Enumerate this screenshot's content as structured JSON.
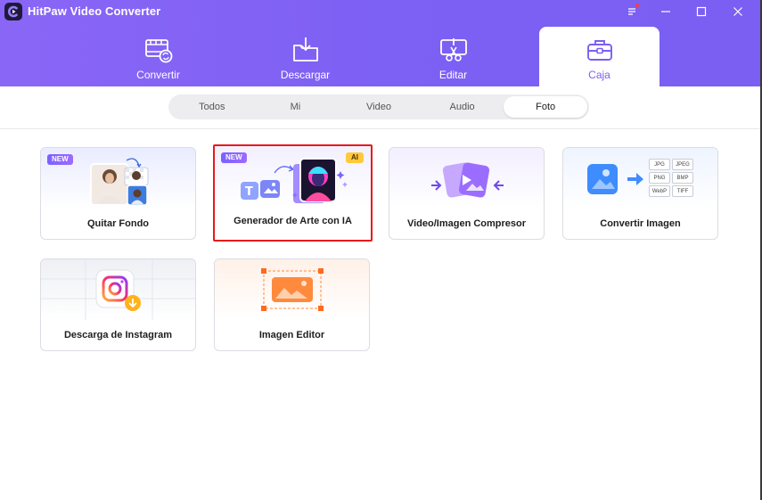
{
  "app": {
    "title": "HitPaw Video Converter",
    "accent_color": "#7b5ef2"
  },
  "window_controls": {
    "menu_icon": "menu-icon",
    "minimize_icon": "minimize-icon",
    "maximize_icon": "maximize-icon",
    "close_icon": "close-icon"
  },
  "main_tabs": [
    {
      "label": "Convertir",
      "icon": "film-convert-icon",
      "active": false
    },
    {
      "label": "Descargar",
      "icon": "folder-download-icon",
      "active": false
    },
    {
      "label": "Editar",
      "icon": "scissors-edit-icon",
      "active": false
    },
    {
      "label": "Caja",
      "icon": "toolbox-icon",
      "active": true
    }
  ],
  "sub_tabs": [
    {
      "label": "Todos",
      "active": false
    },
    {
      "label": "Mi",
      "active": false
    },
    {
      "label": "Video",
      "active": false
    },
    {
      "label": "Audio",
      "active": false
    },
    {
      "label": "Foto",
      "active": true
    }
  ],
  "tools": [
    {
      "label": "Quitar Fondo",
      "badge": "NEW",
      "icon": "remove-background-icon"
    },
    {
      "label": "Generador de Arte con IA",
      "badge": "NEW",
      "badge_right": "AI",
      "icon": "ai-art-generator-icon",
      "highlighted": true
    },
    {
      "label": "Video/Imagen Compresor",
      "icon": "compress-icon"
    },
    {
      "label": "Convertir Imagen",
      "icon": "image-convert-icon",
      "formats": [
        "JPG",
        "JPEG",
        "PNG",
        "BMP",
        "WebP",
        "TIFF"
      ]
    },
    {
      "label": "Descarga de Instagram",
      "icon": "instagram-download-icon"
    },
    {
      "label": "Imagen Editor",
      "icon": "image-editor-icon"
    }
  ],
  "highlight_color": "#e8191c"
}
